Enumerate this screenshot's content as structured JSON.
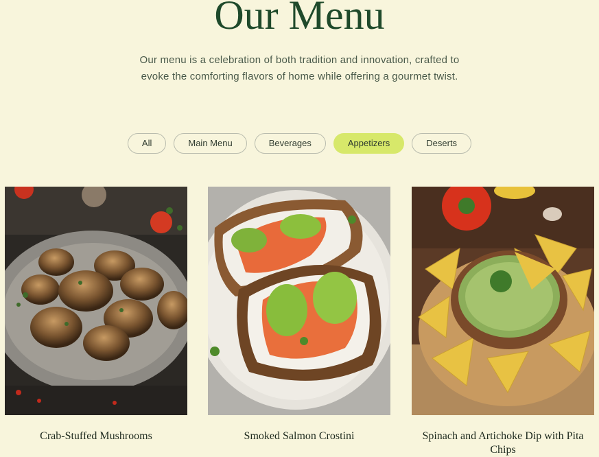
{
  "header": {
    "title": "Our Menu",
    "intro": "Our menu is a celebration of both tradition and innovation, crafted to evoke the comforting flavors of home while offering a gourmet twist."
  },
  "filters": {
    "active": "Appetizers",
    "items": [
      "All",
      "Main Menu",
      "Beverages",
      "Appetizers",
      "Deserts"
    ]
  },
  "colors": {
    "background": "#f8f5dc",
    "title": "#1f4a2b",
    "active_pill": "#d7e86a"
  },
  "dishes": [
    {
      "name": "Crab-Stuffed Mushrooms",
      "image": "stuffed-mushrooms-photo"
    },
    {
      "name": "Smoked Salmon Crostini",
      "image": "salmon-crostini-photo"
    },
    {
      "name": "Spinach and Artichoke Dip with Pita Chips",
      "image": "dip-with-chips-photo"
    }
  ]
}
